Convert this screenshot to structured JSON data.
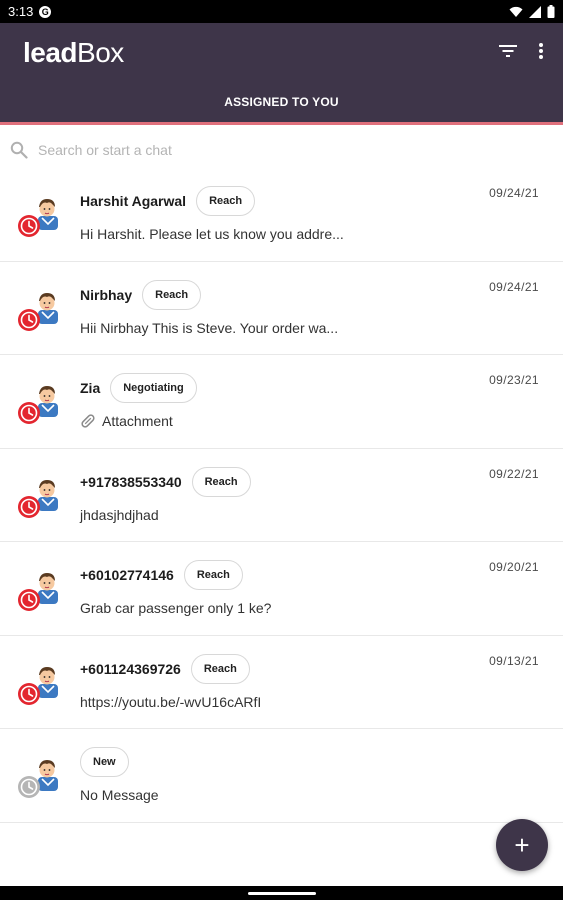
{
  "status_bar": {
    "time": "3:13",
    "app_icon": "G"
  },
  "app": {
    "logo_bold": "lead",
    "logo_regular": "Box",
    "tab": "ASSIGNED TO YOU"
  },
  "search": {
    "placeholder": "Search or start a chat"
  },
  "colors": {
    "appbar": "#3e3549",
    "accent_line": "#e0707c",
    "status_clock_active": "#e3262f",
    "status_clock_inactive": "#b5b5b5"
  },
  "chats": [
    {
      "name": "Harshit Agarwal",
      "badge": "Reach",
      "message": "Hi Harshit. Please let us know you addre...",
      "date": "09/24/21",
      "status": "active"
    },
    {
      "name": "Nirbhay",
      "badge": "Reach",
      "message": "Hii Nirbhay This is Steve. Your order wa...",
      "date": "09/24/21",
      "status": "active"
    },
    {
      "name": "Zia",
      "badge": "Negotiating",
      "message": "Attachment",
      "attachment": true,
      "date": "09/23/21",
      "status": "active"
    },
    {
      "name": "+917838553340",
      "badge": "Reach",
      "message": "jhdasjhdjhad",
      "date": "09/22/21",
      "status": "active"
    },
    {
      "name": "+60102774146",
      "badge": "Reach",
      "message": "Grab car passenger only 1 ke?",
      "date": "09/20/21",
      "status": "active"
    },
    {
      "name": "+601124369726",
      "badge": "Reach",
      "message": "https://youtu.be/-wvU16cARfI",
      "date": "09/13/21",
      "status": "active"
    },
    {
      "name": "",
      "badge": "New",
      "message": "No Message",
      "date": "",
      "status": "inactive"
    }
  ],
  "fab": {
    "label": "+"
  }
}
